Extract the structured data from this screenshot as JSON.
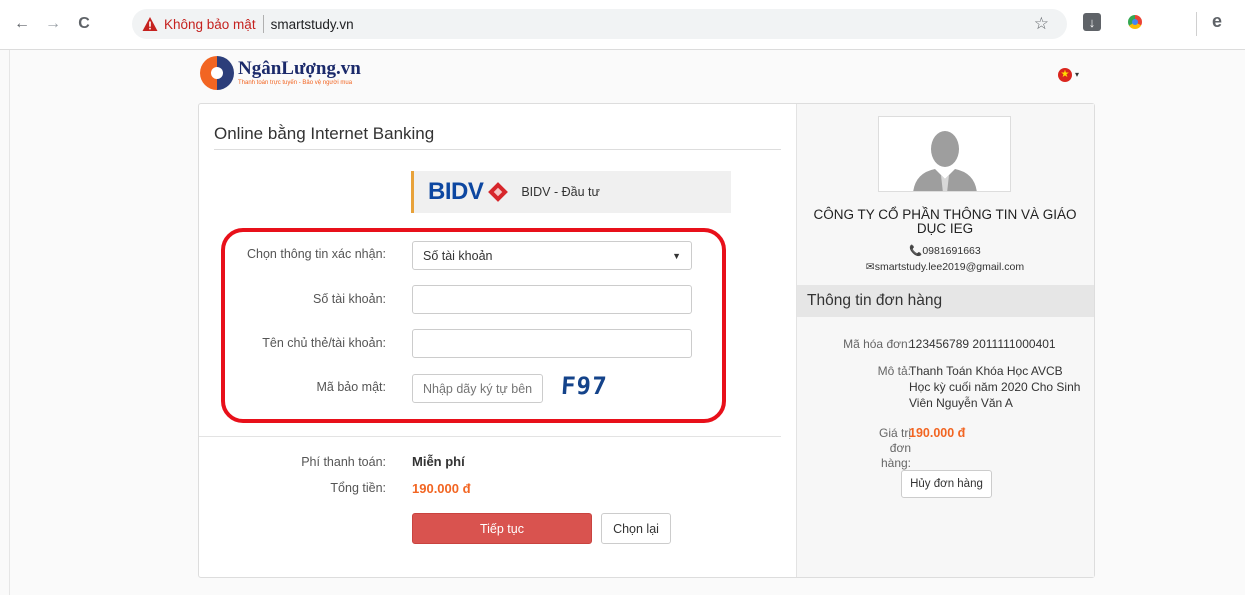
{
  "browser": {
    "nav": {
      "back": "←",
      "forward": "→",
      "reload": "C"
    },
    "security_text": "Không bảo mật",
    "url": "smartstudy.vn",
    "bookmark_icon": "☆",
    "download_icon": "↓",
    "profile_icon": "e"
  },
  "brand": {
    "name": "NgânLượng.vn",
    "tagline": "Thanh toán trực tuyến - Bảo vệ người mua",
    "lang_flag": "★",
    "lang_caret": "▾"
  },
  "payment": {
    "section_title": "Online bằng Internet Banking",
    "bank": {
      "logo_text": "BIDV",
      "name": "BIDV - Đầu tư"
    },
    "form": {
      "verify_label": "Chọn thông tin xác nhận:",
      "verify_value": "Số tài khoản",
      "verify_caret": "▼",
      "account_label": "Số tài khoản:",
      "holder_label": "Tên chủ thẻ/tài khoản:",
      "captcha_label": "Mã bảo mật:",
      "captcha_placeholder": "Nhập dãy ký tự bên",
      "captcha_code": "F97"
    },
    "fee_label": "Phí thanh toán:",
    "fee_value": "Miễn phí",
    "total_label": "Tổng tiền:",
    "total_value": "190.000 đ",
    "continue_label": "Tiếp tục",
    "reset_label": "Chọn lại"
  },
  "merchant": {
    "name": "CÔNG TY CỔ PHẦN THÔNG TIN VÀ GIÁO DỤC IEG",
    "phone": "📞0981691663",
    "email": "✉smartstudy.lee2019@gmail.com"
  },
  "order": {
    "header": "Thông tin đơn hàng",
    "invoice_label": "Mã hóa đơn:",
    "invoice_value": "123456789 2011111000401",
    "desc_label": "Mô tả:",
    "desc_value": "Thanh Toán Khóa Học AVCB Học kỳ cuối năm 2020 Cho Sinh Viên Nguyễn Văn A",
    "value_label": "Giá trị đơn hàng:",
    "value_amount": "190.000 đ",
    "cancel_label": "Hủy đơn hàng"
  },
  "colors": {
    "accent_orange": "#f26522",
    "button_red": "#d9534f",
    "highlight_red": "#e8101a",
    "warning_red": "#c5221f",
    "bank_blue": "#0d47a1"
  }
}
